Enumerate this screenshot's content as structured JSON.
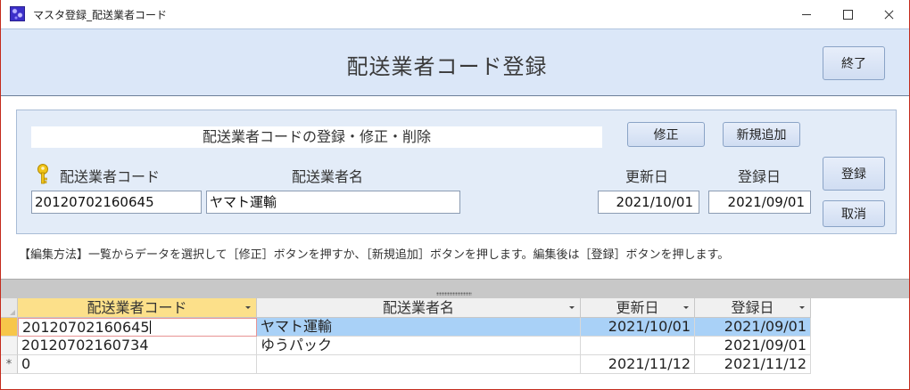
{
  "window": {
    "title": "マスタ登録_配送業者コード"
  },
  "header": {
    "title": "配送業者コード登録",
    "exit_label": "終了"
  },
  "panel": {
    "heading": "配送業者コードの登録・修正・削除",
    "modify_label": "修正",
    "new_label": "新規追加",
    "save_label": "登録",
    "cancel_label": "取消",
    "code_label": "配送業者コード",
    "name_label": "配送業者名",
    "updated_label": "更新日",
    "registered_label": "登録日",
    "code_value": "20120702160645",
    "name_value": "ヤマト運輸",
    "updated_value": "2021/10/01",
    "registered_value": "2021/09/01"
  },
  "help_text": "【編集方法】一覧からデータを選択して［修正］ボタンを押すか、［新規追加］ボタンを押します。編集後は［登録］ボタンを押します。",
  "datasheet": {
    "columns": [
      "配送業者コード",
      "配送業者名",
      "更新日",
      "登録日"
    ],
    "rows": [
      {
        "code": "20120702160645",
        "name": "ヤマト運輸",
        "updated": "2021/10/01",
        "registered": "2021/09/01"
      },
      {
        "code": "20120702160734",
        "name": "ゆうパック",
        "updated": "",
        "registered": "2021/09/01"
      },
      {
        "code": "0",
        "name": "",
        "updated": "2021/11/12",
        "registered": "2021/11/12"
      }
    ],
    "new_row_marker": "*"
  },
  "colors": {
    "header_band": "#dbe7f8",
    "panel": "#e3ecf8",
    "active_header": "#fce08a",
    "selected_row": "#a9d1f7"
  }
}
